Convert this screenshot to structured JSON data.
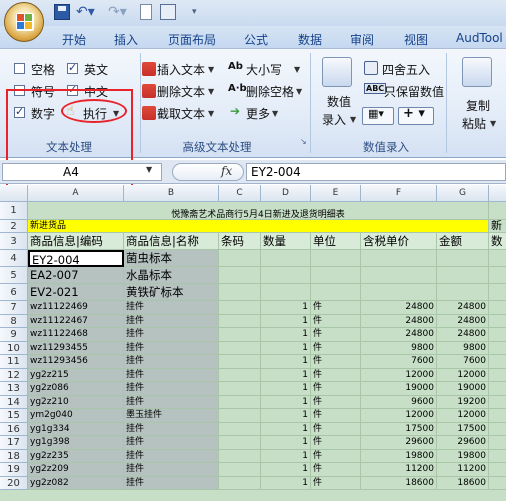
{
  "tabs": [
    "开始",
    "插入",
    "页面布局",
    "公式",
    "数据",
    "审阅",
    "视图",
    "AudTool"
  ],
  "ribbon": {
    "group1": {
      "label": "文本处理",
      "checkboxes": [
        {
          "label": "空格",
          "checked": false
        },
        {
          "label": "英文",
          "checked": true
        },
        {
          "label": "符号",
          "checked": false
        },
        {
          "label": "中文",
          "checked": true
        },
        {
          "label": "数字",
          "checked": true
        }
      ],
      "execute_label": "执行"
    },
    "group2": {
      "label": "高级文本处理",
      "items": [
        "插入文本",
        "删除文本",
        "截取文本",
        "大小写",
        "删除空格",
        "更多"
      ]
    },
    "group3": {
      "label": "数值录入",
      "entry_label_1": "数值",
      "entry_label_2": "录入",
      "items": [
        "四舍五入",
        "只保留数值"
      ]
    },
    "group4": {
      "copy_1": "复制",
      "copy_2": "粘贴"
    }
  },
  "formula_bar": {
    "name_box": "A4",
    "fx": "fx",
    "formula": "EY2-004"
  },
  "columns": [
    "A",
    "B",
    "C",
    "D",
    "E",
    "F",
    "G"
  ],
  "sheet": {
    "row1_title": "悦豫斋艺术品商行5月4日新进及退货明细表",
    "row2_label": "新进货品",
    "row2_h": "新",
    "headers": [
      "商品信息|编码",
      "商品信息|名称",
      "条码",
      "数量",
      "单位",
      "含税单价",
      "金额"
    ],
    "header_h": "数",
    "rows": [
      {
        "n": "4",
        "a": "EY2-004",
        "b": "菌虫标本",
        "d": "",
        "e": "",
        "f": "",
        "g": ""
      },
      {
        "n": "5",
        "a": "EA2-007",
        "b": "水晶标本",
        "d": "",
        "e": "",
        "f": "",
        "g": ""
      },
      {
        "n": "6",
        "a": "EV2-021",
        "b": "黄铁矿标本",
        "d": "",
        "e": "",
        "f": "",
        "g": ""
      },
      {
        "n": "7",
        "a": "wz11122469",
        "b": "挂件",
        "d": "1",
        "e": "件",
        "f": "24800",
        "g": "24800"
      },
      {
        "n": "8",
        "a": "wz11122467",
        "b": "挂件",
        "d": "1",
        "e": "件",
        "f": "24800",
        "g": "24800"
      },
      {
        "n": "9",
        "a": "wz11122468",
        "b": "挂件",
        "d": "1",
        "e": "件",
        "f": "24800",
        "g": "24800"
      },
      {
        "n": "10",
        "a": "wz11293455",
        "b": "挂件",
        "d": "1",
        "e": "件",
        "f": "9800",
        "g": "9800"
      },
      {
        "n": "11",
        "a": "wz11293456",
        "b": "挂件",
        "d": "1",
        "e": "件",
        "f": "7600",
        "g": "7600"
      },
      {
        "n": "12",
        "a": "yg2z215",
        "b": "挂件",
        "d": "1",
        "e": "件",
        "f": "12000",
        "g": "12000"
      },
      {
        "n": "13",
        "a": "yg2z086",
        "b": "挂件",
        "d": "1",
        "e": "件",
        "f": "19000",
        "g": "19000"
      },
      {
        "n": "14",
        "a": "yg2z210",
        "b": "挂件",
        "d": "1",
        "e": "件",
        "f": "9600",
        "g": "19200"
      },
      {
        "n": "15",
        "a": "ym2g040",
        "b": "墨玉挂件",
        "d": "1",
        "e": "件",
        "f": "12000",
        "g": "12000"
      },
      {
        "n": "16",
        "a": "yg1g334",
        "b": "挂件",
        "d": "1",
        "e": "件",
        "f": "17500",
        "g": "17500"
      },
      {
        "n": "17",
        "a": "yg1g398",
        "b": "挂件",
        "d": "1",
        "e": "件",
        "f": "29600",
        "g": "29600"
      },
      {
        "n": "18",
        "a": "yg2z235",
        "b": "挂件",
        "d": "1",
        "e": "件",
        "f": "19800",
        "g": "19800"
      },
      {
        "n": "19",
        "a": "yg2z209",
        "b": "挂件",
        "d": "1",
        "e": "件",
        "f": "11200",
        "g": "11200"
      },
      {
        "n": "20",
        "a": "yg2z082",
        "b": "挂件",
        "d": "1",
        "e": "件",
        "f": "18600",
        "g": "18600"
      }
    ]
  },
  "colors": {
    "accent_red": "#e8232a",
    "sheet_green": "#c6dfc6",
    "yellow_row": "#ffff00",
    "selection_gray": "#b6c2c0"
  }
}
